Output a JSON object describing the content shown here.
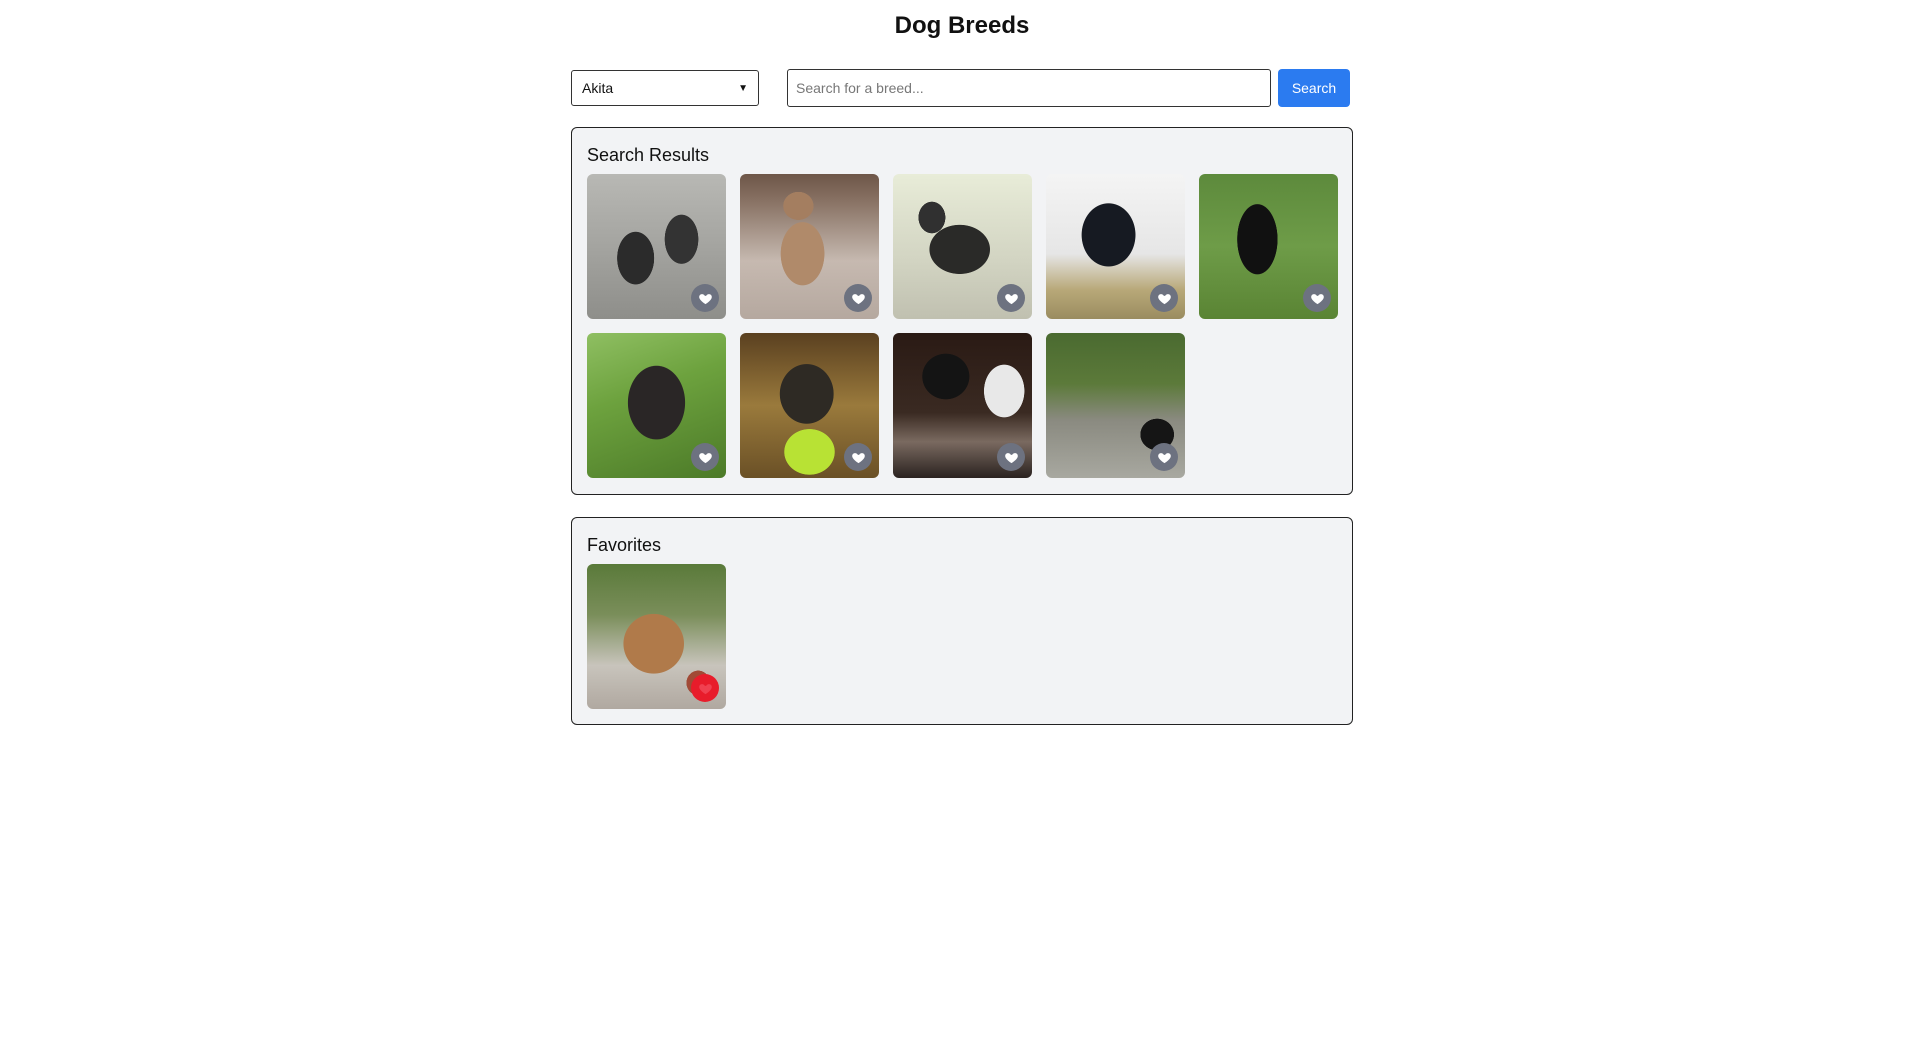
{
  "app": {
    "title": "Dog Breeds"
  },
  "controls": {
    "breed_select": {
      "selected": "Akita"
    },
    "search": {
      "placeholder": "Search for a breed...",
      "value": "",
      "button_label": "Search"
    }
  },
  "results": {
    "heading": "Search Results",
    "items": [
      {
        "photo": "two-dark-dogs-on-leash",
        "favorited": false
      },
      {
        "photo": "tan-dog-on-deck",
        "favorited": false
      },
      {
        "photo": "dark-dog-standing-snow",
        "favorited": false
      },
      {
        "photo": "black-puppy-grass",
        "favorited": false
      },
      {
        "photo": "black-dog-lawn",
        "favorited": false
      },
      {
        "photo": "dark-dog-closeup-green",
        "favorited": false
      },
      {
        "photo": "dark-dog-tennis-ball",
        "favorited": false
      },
      {
        "photo": "black-dog-books",
        "favorited": false
      },
      {
        "photo": "black-dog-garden-rocks",
        "favorited": false
      }
    ]
  },
  "favorites": {
    "heading": "Favorites",
    "items": [
      {
        "photo": "brown-dog-lying-patio",
        "favorited": true
      }
    ]
  },
  "colors": {
    "accent": "#2b7bf0",
    "favorite_active": "#e81c2b",
    "favorite_inactive": "#6d7280",
    "panel_bg": "#f2f3f5"
  },
  "icons": {
    "favorite": "heart-icon",
    "select_caret": "chevron-down-icon"
  }
}
